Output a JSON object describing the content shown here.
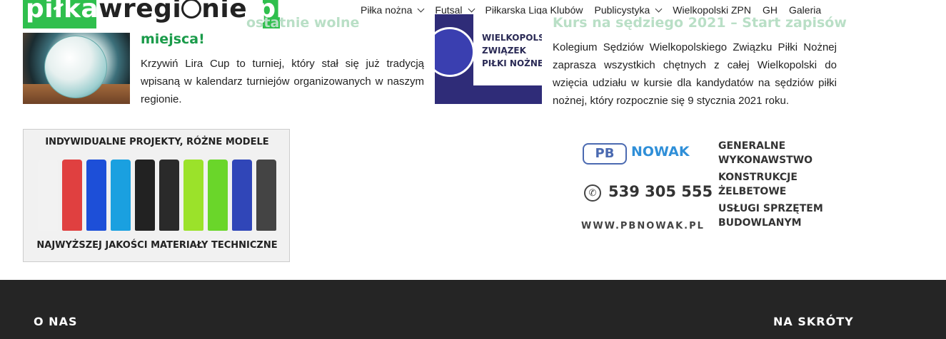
{
  "header": {
    "logo": {
      "part1": "piłka",
      "part2": "wregi",
      "part3": "nie",
      "part4": ".pl"
    },
    "nav": [
      {
        "label": "Piłka nożna",
        "dropdown": true
      },
      {
        "label": "Futsal",
        "dropdown": true
      },
      {
        "label": "Piłkarska Liga Klubów",
        "dropdown": false
      },
      {
        "label": "Publicystyka",
        "dropdown": true
      },
      {
        "label": "Wielkopolski ZPN",
        "dropdown": false
      },
      {
        "label": "GH",
        "dropdown": false
      },
      {
        "label": "Galeria",
        "dropdown": false
      }
    ]
  },
  "articles": [
    {
      "title_visible": "miejsca!",
      "title_partial": "ostatnie wolne",
      "excerpt": "Krzywiń Lira Cup to turniej, który stał się już tradycją wpisaną w kalendarz turniejów organizowanych w naszym regionie."
    },
    {
      "title": "Kurs na sędziego 2021 – Start zapisów",
      "thumb_text": [
        "WIELKOPOLS",
        "ZWIĄZEK",
        "PIŁKI NOŻNE"
      ],
      "excerpt": "Kolegium Sędziów Wielkopolskiego Związku Piłki Nożnej zaprasza wszystkich chętnych z całej Wielkopolski do wzięcia udziału w kursie dla kandydatów na sędziów piłki nożnej, który rozpocznie się 9 stycznia 2021 roku."
    }
  ],
  "banners": {
    "kits": {
      "top": "INDYWIDUALNE PROJEKTY, RÓŻNE MODELE",
      "bottom": "NAJWYŻSZEJ JAKOŚCI MATERIAŁY TECHNICZNE",
      "colors": [
        "#f2f2f2",
        "#e04040",
        "#1d4fd8",
        "#1aa0e0",
        "#222222",
        "#2a2a2a",
        "#9be22a",
        "#6ad62a",
        "#3046b8",
        "#444444"
      ]
    },
    "pbnowak": {
      "logo_box": "PB",
      "logo_name": "NOWAK",
      "phone": "539 305 555",
      "website": "WWW.PBNOWAK.PL",
      "services": [
        "GENERALNE",
        "WYKONAWSTWO",
        "KONSTRUKCJE",
        "ŻELBETOWE",
        "USŁUGI SPRZĘTEM",
        "BUDOWLANYM"
      ]
    }
  },
  "footer": {
    "col1_title": "O NAS",
    "col2_title": "NA SKRÓTY"
  }
}
